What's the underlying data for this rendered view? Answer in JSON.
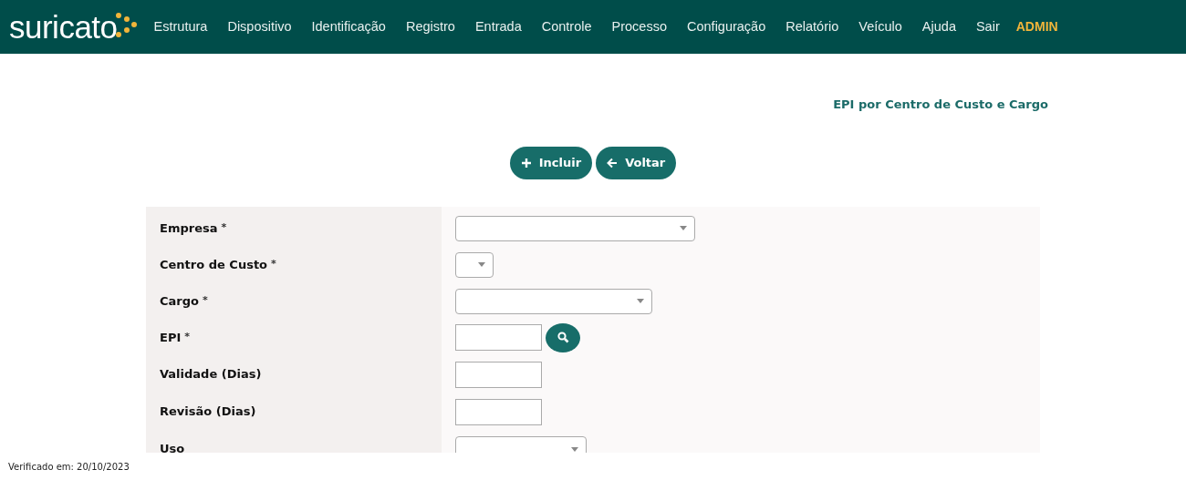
{
  "brand": {
    "name": "suricato"
  },
  "menu": [
    {
      "label": "Estrutura",
      "kind": "link"
    },
    {
      "label": "Dispositivo",
      "kind": "link"
    },
    {
      "label": "Identificação",
      "kind": "link"
    },
    {
      "label": "Registro",
      "kind": "link"
    },
    {
      "label": "Entrada",
      "kind": "link"
    },
    {
      "label": "Controle",
      "kind": "link"
    },
    {
      "label": "Processo",
      "kind": "link"
    },
    {
      "label": "Configuração",
      "kind": "link"
    },
    {
      "label": "Relatório",
      "kind": "link"
    },
    {
      "label": "Veículo",
      "kind": "link"
    },
    {
      "label": "Ajuda",
      "kind": "link"
    },
    {
      "label": "Sair",
      "kind": "link"
    },
    {
      "label": "ADMIN",
      "kind": "user"
    }
  ],
  "page_title": "EPI por Centro de Custo e Cargo",
  "actions": [
    {
      "label": "Incluir",
      "kind": "add"
    },
    {
      "label": "Voltar",
      "kind": "back"
    }
  ],
  "fields": [
    {
      "label": "Empresa",
      "marker": "*",
      "kind": "select"
    },
    {
      "label": "Centro de Custo",
      "marker": "*",
      "kind": "select"
    },
    {
      "label": "Cargo",
      "marker": "*",
      "kind": "select"
    },
    {
      "label": "EPI",
      "marker": "*",
      "kind": "input",
      "search": true
    },
    {
      "label": "Validade (Dias)",
      "kind": "input"
    },
    {
      "label": "Revisão (Dias)",
      "kind": "input"
    },
    {
      "label": "Uso",
      "kind": "select"
    }
  ],
  "footer": "Verificado em: 20/10/2023"
}
